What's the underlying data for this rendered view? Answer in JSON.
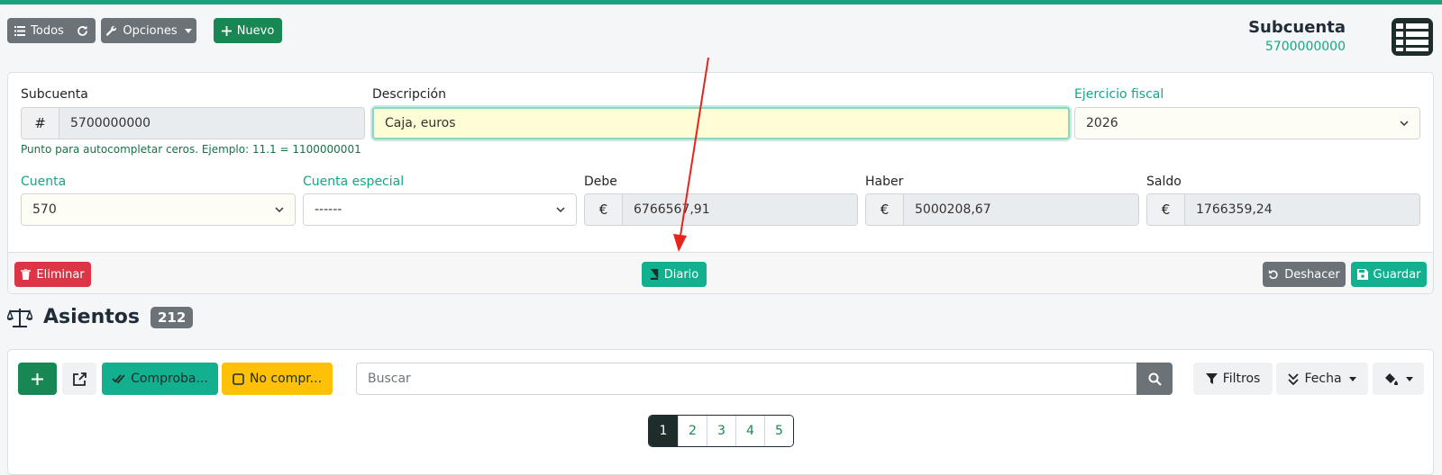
{
  "toolbar": {
    "all_label": "Todos",
    "options_label": "Opciones",
    "new_label": "Nuevo"
  },
  "header": {
    "title": "Subcuenta",
    "code": "5700000000"
  },
  "form": {
    "subcuenta_label": "Subcuenta",
    "subcuenta_value": "5700000000",
    "subcuenta_help": "Punto para autocompletar ceros. Ejemplo: 11.1 = 1100000001",
    "descripcion_label": "Descripción",
    "descripcion_value": "Caja, euros",
    "ejercicio_label": "Ejercicio fiscal",
    "ejercicio_value": "2026",
    "cuenta_label": "Cuenta",
    "cuenta_value": "570",
    "cuenta_especial_label": "Cuenta especial",
    "cuenta_especial_value": "------",
    "debe_label": "Debe",
    "debe_value": "6766567,91",
    "haber_label": "Haber",
    "haber_value": "5000208,67",
    "saldo_label": "Saldo",
    "saldo_value": "1766359,24",
    "currency_symbol": "€",
    "hash_symbol": "#"
  },
  "footer": {
    "delete_label": "Eliminar",
    "diario_label": "Diario",
    "undo_label": "Deshacer",
    "save_label": "Guardar"
  },
  "asientos": {
    "title": "Asientos",
    "count": "212",
    "checked_label": "Comproba...",
    "unchecked_label": "No compr...",
    "search_placeholder": "Buscar",
    "filters_label": "Filtros",
    "sort_label": "Fecha",
    "pages": [
      "1",
      "2",
      "3",
      "4",
      "5"
    ],
    "active_page": "1"
  },
  "colors": {
    "accent": "#12b08f",
    "green": "#198754",
    "danger": "#dc3545",
    "warning": "#ffc107",
    "annotation_arrow": "#e8231e"
  }
}
